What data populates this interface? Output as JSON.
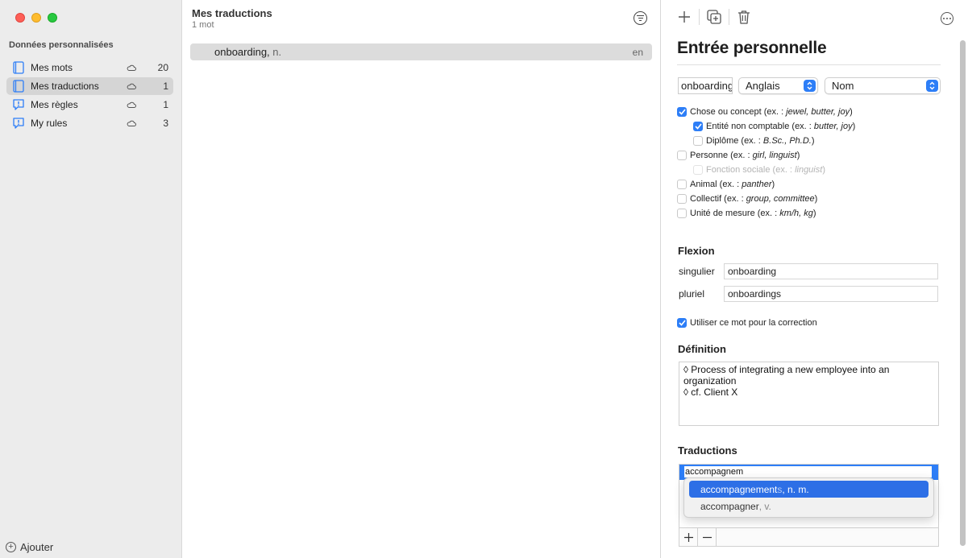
{
  "sidebar": {
    "section_title": "Données personnalisées",
    "items": [
      {
        "label": "Mes mots",
        "count": "20",
        "icon": "book-icon",
        "selected": false
      },
      {
        "label": "Mes traductions",
        "count": "1",
        "icon": "book-icon",
        "selected": true
      },
      {
        "label": "Mes règles",
        "count": "1",
        "icon": "rule-bubble-icon",
        "selected": false
      },
      {
        "label": "My rules",
        "count": "3",
        "icon": "rule-bubble-icon",
        "selected": false
      }
    ],
    "add_label": "Ajouter"
  },
  "list": {
    "title": "Mes traductions",
    "subtitle": "1 mot",
    "rows": [
      {
        "word": "onboarding,",
        "pos": " n.",
        "lang": "en"
      }
    ]
  },
  "entry": {
    "title": "Entrée personnelle",
    "word_value": "onboarding",
    "language_selected": "Anglais",
    "category_selected": "Nom",
    "categories": {
      "chose": {
        "text": "Chose ou concept (ex. : ",
        "examples": "jewel, butter, joy",
        "close": ")",
        "checked": true
      },
      "non_comptable": {
        "text": "Entité non comptable (ex. : ",
        "examples": "butter, joy",
        "close": ")",
        "checked": true
      },
      "diplome": {
        "text": "Diplôme (ex. : ",
        "examples": "B.Sc., Ph.D.",
        "close": ")",
        "checked": false
      },
      "personne": {
        "text": "Personne (ex. : ",
        "examples": "girl, linguist",
        "close": ")",
        "checked": false
      },
      "fonction": {
        "text": "Fonction sociale (ex. : ",
        "examples": "linguist",
        "close": ")",
        "checked": false
      },
      "animal": {
        "text": "Animal (ex. : ",
        "examples": "panther",
        "close": ")",
        "checked": false
      },
      "collectif": {
        "text": "Collectif (ex. : ",
        "examples": "group, committee",
        "close": ")",
        "checked": false
      },
      "unite": {
        "text": "Unité de mesure (ex. : ",
        "examples": "km/h, kg",
        "close": ")",
        "checked": false
      }
    },
    "inflection": {
      "heading": "Flexion",
      "singular_label": "singulier",
      "singular_value": "onboarding",
      "plural_label": "pluriel",
      "plural_value": "onboardings"
    },
    "use_for_correction": {
      "label": "Utiliser ce mot pour la correction",
      "checked": true
    },
    "definition": {
      "heading": "Définition",
      "line1": "◊ Process of integrating a new employee into an organization",
      "line2": "◊ cf. Client X"
    },
    "translations": {
      "heading": "Traductions",
      "editing_value": "accompagnem",
      "suggestions": [
        {
          "typed": "accompagnement",
          "rest": "s",
          "pos": ", n. m."
        },
        {
          "typed": "accompagner",
          "rest": "",
          "pos": ", v."
        }
      ]
    }
  },
  "colors": {
    "accent": "#2d7ef7",
    "selection": "#2d6fe6"
  }
}
